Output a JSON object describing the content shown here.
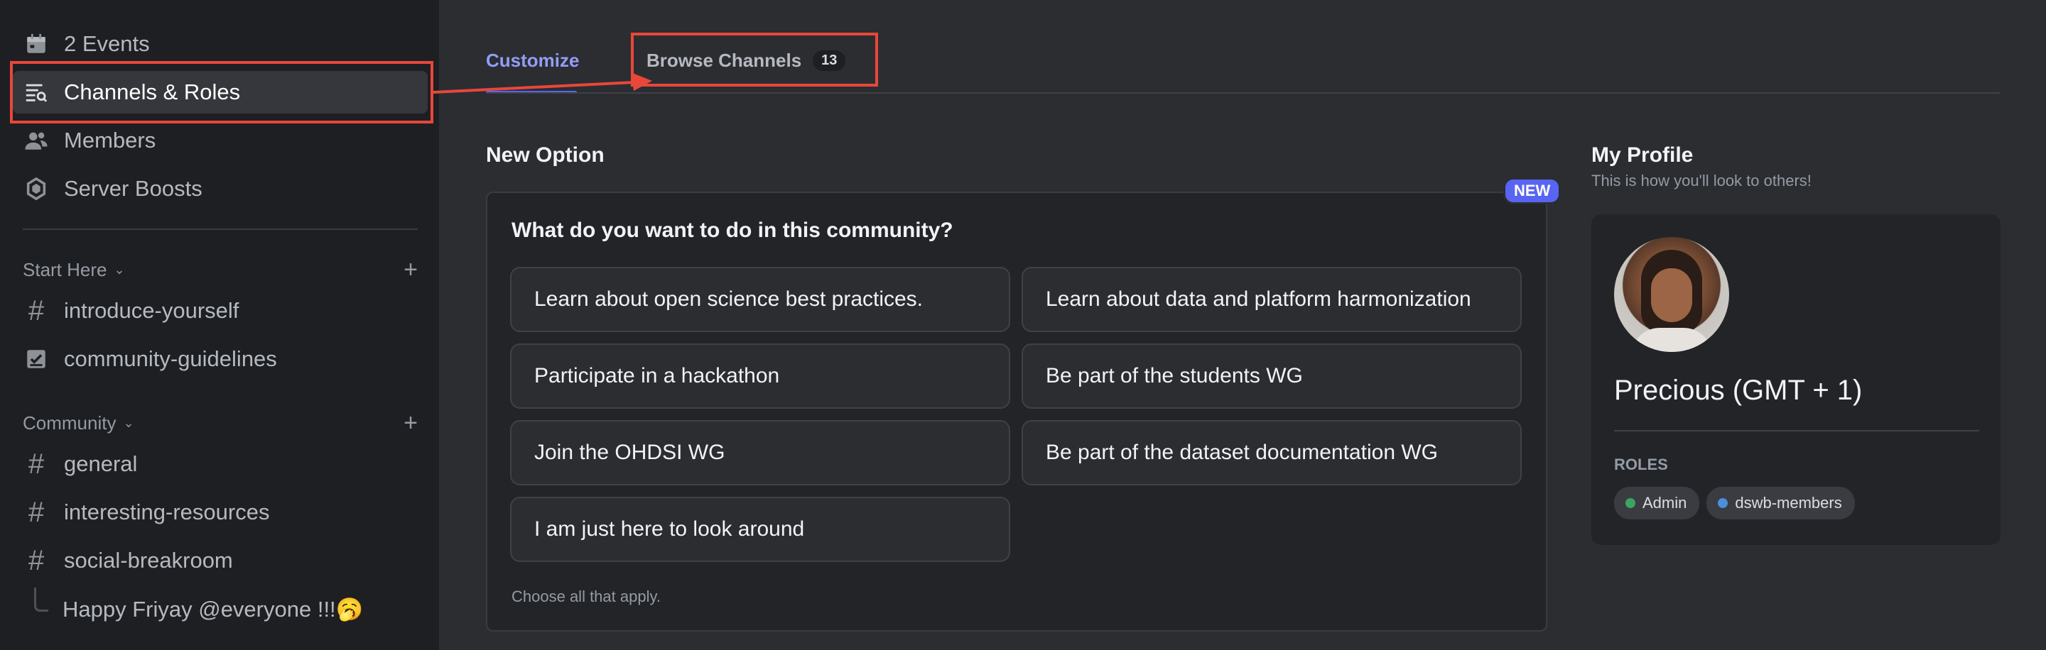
{
  "sidebar": {
    "top_items": [
      {
        "label": "2 Events",
        "icon": "calendar-icon"
      },
      {
        "label": "Channels & Roles",
        "icon": "channels-browse-icon"
      },
      {
        "label": "Members",
        "icon": "members-icon"
      },
      {
        "label": "Server Boosts",
        "icon": "boost-icon"
      }
    ],
    "sections": [
      {
        "title": "Start Here",
        "channels": [
          {
            "label": "introduce-yourself",
            "icon": "hash-icon"
          },
          {
            "label": "community-guidelines",
            "icon": "rules-icon"
          }
        ]
      },
      {
        "title": "Community",
        "channels": [
          {
            "label": "general",
            "icon": "hash-icon"
          },
          {
            "label": "interesting-resources",
            "icon": "hash-icon"
          },
          {
            "label": "social-breakroom",
            "icon": "hash-icon"
          }
        ]
      }
    ],
    "thread": {
      "label": "Happy Friyay @everyone !!!🥱"
    }
  },
  "tabs": [
    {
      "label": "Customize",
      "active": true
    },
    {
      "label": "Browse Channels",
      "count": "13",
      "active": false
    }
  ],
  "new_option": {
    "section_title": "New Option",
    "badge": "NEW",
    "question": "What do you want to do in this community?",
    "options": [
      "Learn about open science best practices.",
      "Learn about data and platform harmonization",
      "Participate in a hackathon",
      "Be part of the students WG",
      "Join the OHDSI WG",
      "Be part of the dataset documentation WG",
      "I am just here to look around"
    ],
    "hint": "Choose all that apply."
  },
  "profile": {
    "title": "My Profile",
    "subtitle": "This is how you'll look to others!",
    "display_name": "Precious (GMT + 1)",
    "roles_label": "ROLES",
    "roles": [
      {
        "name": "Admin",
        "color": "#3ba55d"
      },
      {
        "name": "dswb-members",
        "color": "#4a90d9"
      }
    ]
  },
  "colors": {
    "accent": "#5865f2",
    "annotation": "#e8473a"
  }
}
